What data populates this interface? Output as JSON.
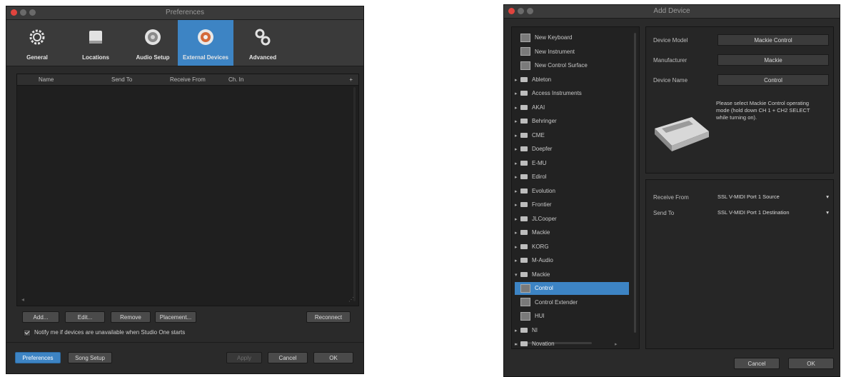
{
  "prefs": {
    "title": "Preferences",
    "tabs": [
      {
        "label": "General",
        "icon": "gear-icon"
      },
      {
        "label": "Locations",
        "icon": "book-icon"
      },
      {
        "label": "Audio Setup",
        "icon": "speaker-icon"
      },
      {
        "label": "External Devices",
        "icon": "device-icon"
      },
      {
        "label": "Advanced",
        "icon": "gears-icon"
      }
    ],
    "columns": [
      "Name",
      "Send To",
      "Receive From",
      "Ch. In",
      "+"
    ],
    "buttons": {
      "add": "Add...",
      "edit": "Edit...",
      "remove": "Remove",
      "placement": "Placement...",
      "reconnect": "Reconnect"
    },
    "checkbox_label": "Notify me if devices are unavailable when Studio One starts",
    "footer": {
      "preferences": "Preferences",
      "song_setup": "Song Setup",
      "apply": "Apply",
      "cancel": "Cancel",
      "ok": "OK"
    }
  },
  "adddev": {
    "title": "Add Device",
    "tree": [
      {
        "label": "New Keyboard",
        "kind": "device"
      },
      {
        "label": "New Instrument",
        "kind": "device"
      },
      {
        "label": "New Control Surface",
        "kind": "device"
      },
      {
        "label": "Ableton",
        "kind": "folder"
      },
      {
        "label": "Access Instruments",
        "kind": "folder"
      },
      {
        "label": "AKAI",
        "kind": "folder"
      },
      {
        "label": "Behringer",
        "kind": "folder"
      },
      {
        "label": "CME",
        "kind": "folder"
      },
      {
        "label": "Doepfer",
        "kind": "folder"
      },
      {
        "label": "E-MU",
        "kind": "folder"
      },
      {
        "label": "Edirol",
        "kind": "folder"
      },
      {
        "label": "Evolution",
        "kind": "folder"
      },
      {
        "label": "Frontier",
        "kind": "folder"
      },
      {
        "label": "JLCooper",
        "kind": "folder"
      },
      {
        "label": "Mackie",
        "kind": "folder"
      },
      {
        "label": "KORG",
        "kind": "folder"
      },
      {
        "label": "M-Audio",
        "kind": "folder"
      },
      {
        "label": "Mackie",
        "kind": "folder-open"
      },
      {
        "label": "Control",
        "kind": "device",
        "selected": true
      },
      {
        "label": "Control Extender",
        "kind": "device"
      },
      {
        "label": "HUI",
        "kind": "device"
      },
      {
        "label": "NI",
        "kind": "folder"
      },
      {
        "label": "Novation",
        "kind": "folder"
      }
    ],
    "fields": {
      "model_label": "Device Model",
      "model_value": "Mackie Control",
      "manufacturer_label": "Manufacturer",
      "manufacturer_value": "Mackie",
      "name_label": "Device Name",
      "name_value": "Control",
      "info_text": "Please select Mackie Control operating mode (hold down CH 1 + CH2 SELECT while turning on).",
      "receive_label": "Receive From",
      "receive_value": "SSL V-MIDI Port 1 Source",
      "send_label": "Send To",
      "send_value": "SSL V-MIDI Port 1 Destination"
    },
    "buttons": {
      "cancel": "Cancel",
      "ok": "OK"
    }
  },
  "colors": {
    "accent": "#3d84c4",
    "window_bg": "#2a2a2a",
    "close": "#e0443e"
  }
}
